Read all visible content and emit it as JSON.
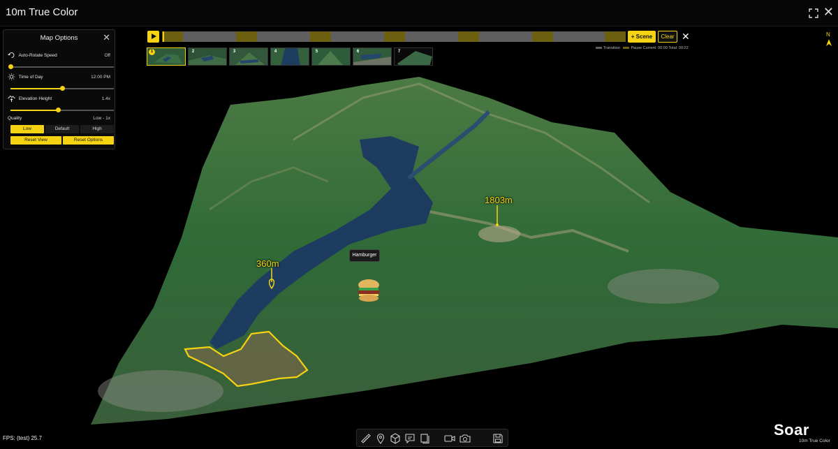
{
  "header": {
    "title": "10m True Color"
  },
  "panel": {
    "title": "Map Options",
    "rows": [
      {
        "label": "Auto-Rotate Speed",
        "value": "Off",
        "slider": 0.0
      },
      {
        "label": "Time of Day",
        "value": "12:00 PM",
        "slider": 0.5
      },
      {
        "label": "Elevation Height",
        "value": "1.4x",
        "slider": 0.46
      }
    ],
    "quality": {
      "label": "Quality",
      "value": "Low - 1x",
      "options": [
        "Low",
        "Default",
        "High"
      ],
      "selected": "Low"
    },
    "reset_view": "Reset View",
    "reset_options": "Reset Options"
  },
  "timeline": {
    "add_scene": "+ Scene",
    "clear": "Clear",
    "legend_transition": "Transition",
    "legend_pause": "Pause",
    "current_label": "Current: 00:00",
    "total_label": "Total: 00:22",
    "scenes": [
      "1",
      "2",
      "3",
      "4",
      "5",
      "6",
      "7"
    ],
    "selected_scene": "1"
  },
  "compass": {
    "label": "N"
  },
  "annotations": {
    "peak_label": "1803m",
    "pin_label": "360m",
    "marker_tooltip": "Hamburger"
  },
  "footer": {
    "fps": "FPS: (test) 25.7",
    "brand": "Soar",
    "brand_sub": "10m True Color"
  },
  "colors": {
    "accent": "#f5d312",
    "background": "#000000"
  },
  "toolbar_icons": [
    "ruler-icon",
    "pin-icon",
    "cube-icon",
    "comment-icon",
    "layers-icon",
    "video-icon",
    "camera-icon",
    "save-icon"
  ]
}
